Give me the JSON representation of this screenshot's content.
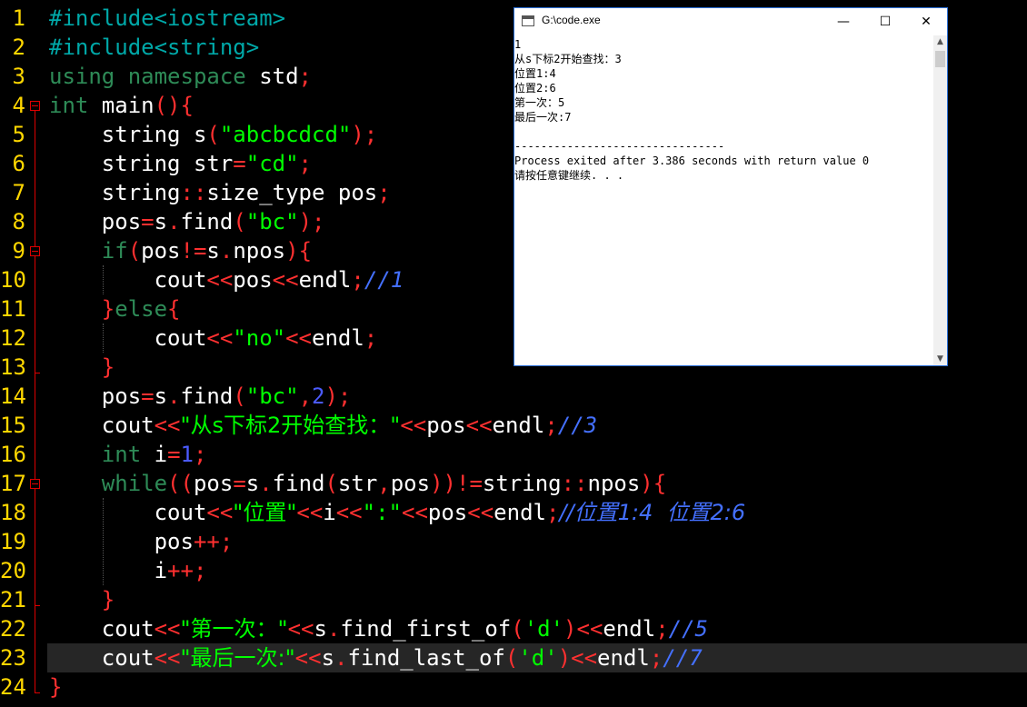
{
  "editor": {
    "lines": [
      {
        "num": "1"
      },
      {
        "num": "2"
      },
      {
        "num": "3"
      },
      {
        "num": "4"
      },
      {
        "num": "5"
      },
      {
        "num": "6"
      },
      {
        "num": "7"
      },
      {
        "num": "8"
      },
      {
        "num": "9"
      },
      {
        "num": "10"
      },
      {
        "num": "11"
      },
      {
        "num": "12"
      },
      {
        "num": "13"
      },
      {
        "num": "14"
      },
      {
        "num": "15"
      },
      {
        "num": "16"
      },
      {
        "num": "17"
      },
      {
        "num": "18"
      },
      {
        "num": "19"
      },
      {
        "num": "20"
      },
      {
        "num": "21"
      },
      {
        "num": "22"
      },
      {
        "num": "23"
      },
      {
        "num": "24"
      }
    ],
    "tokens": {
      "l1": {
        "a": "#include<iostream>"
      },
      "l2": {
        "a": "#include<string>"
      },
      "l3": {
        "a": "using namespace ",
        "b": "std",
        "c": ";"
      },
      "l4": {
        "a": "int",
        "b": " main",
        "c": "(){"
      },
      "l5": {
        "a": "string s",
        "b": "(",
        "c": "\"abcbcdcd\"",
        "d": ");"
      },
      "l6": {
        "a": "string str",
        "b": "=",
        "c": "\"cd\"",
        "d": ";"
      },
      "l7": {
        "a": "string",
        "b": "::",
        "c": "size_type pos",
        "d": ";"
      },
      "l8": {
        "a": "pos",
        "b": "=",
        "c": "s",
        "d": ".",
        "e": "find",
        "f": "(",
        "g": "\"bc\"",
        "h": ");"
      },
      "l9": {
        "a": "if",
        "b": "(",
        "c": "pos",
        "d": "!=",
        "e": "s",
        "f": ".",
        "g": "npos",
        "h": "){"
      },
      "l10": {
        "a": "cout",
        "b": "<<",
        "c": "pos",
        "d": "<<",
        "e": "endl",
        "f": ";",
        "g": "//1"
      },
      "l11": {
        "a": "}",
        "b": "else",
        "c": "{"
      },
      "l12": {
        "a": "cout",
        "b": "<<",
        "c": "\"no\"",
        "d": "<<",
        "e": "endl",
        "f": ";"
      },
      "l13": {
        "a": "}"
      },
      "l14": {
        "a": "pos",
        "b": "=",
        "c": "s",
        "d": ".",
        "e": "find",
        "f": "(",
        "g": "\"bc\"",
        "h": ",",
        "i": "2",
        "j": ");"
      },
      "l15": {
        "a": "cout",
        "b": "<<",
        "c": "\"从s下标2开始查找：\"",
        "d": "<<",
        "e": "pos",
        "f": "<<",
        "g": "endl",
        "h": ";",
        "i": "//3"
      },
      "l16": {
        "a": "int",
        "b": " i",
        "c": "=",
        "d": "1",
        "e": ";"
      },
      "l17": {
        "a": "while",
        "b": "((",
        "c": "pos",
        "d": "=",
        "e": "s",
        "f": ".",
        "g": "find",
        "h": "(",
        "i": "str",
        "j": ",",
        "k": "pos",
        "l": "))!=",
        "m": "string",
        "n": "::",
        "o": "npos",
        "p": "){"
      },
      "l18": {
        "a": "cout",
        "b": "<<",
        "c": "\"位置\"",
        "d": "<<",
        "e": "i",
        "f": "<<",
        "g": "\":\"",
        "h": "<<",
        "i": "pos",
        "j": "<<",
        "k": "endl",
        "l": ";",
        "m": "//位置1:4  位置2:6"
      },
      "l19": {
        "a": "pos",
        "b": "++;"
      },
      "l20": {
        "a": "i",
        "b": "++;"
      },
      "l21": {
        "a": "}"
      },
      "l22": {
        "a": "cout",
        "b": "<<",
        "c": "\"第一次：\"",
        "d": "<<",
        "e": "s",
        "f": ".",
        "g": "find_first_of",
        "h": "(",
        "i": "'d'",
        "j": ")<<",
        "k": "endl",
        "l": ";",
        "m": "//5"
      },
      "l23": {
        "a": "cout",
        "b": "<<",
        "c": "\"最后一次:\"",
        "d": "<<",
        "e": "s",
        "f": ".",
        "g": "find_last_of",
        "h": "(",
        "i": "'d'",
        "j": ")<<",
        "k": "endl",
        "l": ";",
        "m": "//7"
      },
      "l24": {
        "a": "}"
      }
    },
    "current_line": 23,
    "colors": {
      "background": "#000000",
      "line_numbers": "#ffd700",
      "keyword": "#2e8b57",
      "preprocessor": "#00a8a8",
      "string": "#00ff00",
      "operator": "#ff3030",
      "number": "#4b5bff",
      "comment": "#4470ff",
      "identifier": "#ffffff"
    }
  },
  "console": {
    "title": "G:\\code.exe",
    "icon": "console-window-icon",
    "controls": {
      "minimize": "—",
      "maximize": "☐",
      "close": "✕"
    },
    "output": [
      "1",
      "从s下标2开始查找：3",
      "位置1:4",
      "位置2:6",
      "第一次：5",
      "最后一次:7",
      "",
      "--------------------------------",
      "Process exited after 3.386 seconds with return value 0",
      "请按任意键继续. . ."
    ]
  }
}
